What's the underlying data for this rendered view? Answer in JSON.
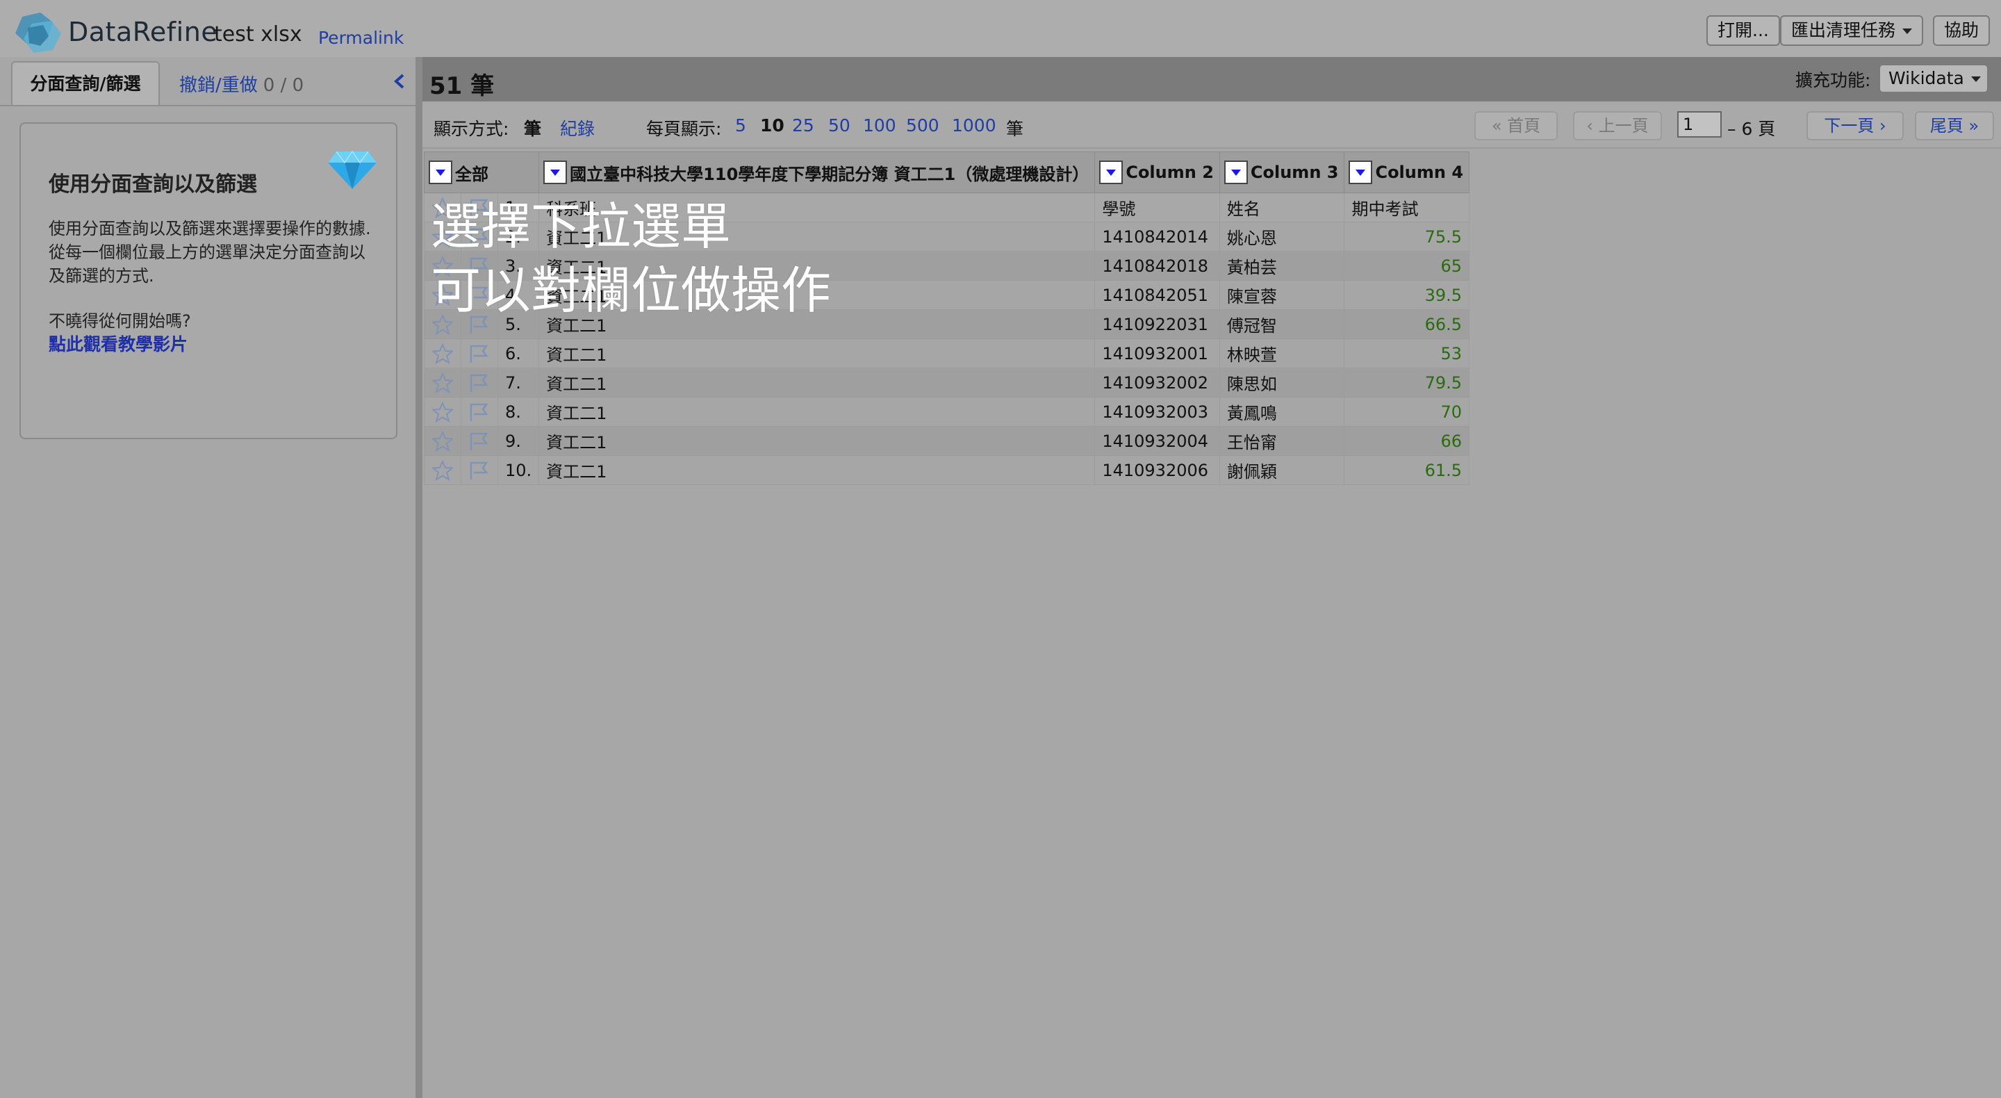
{
  "app": {
    "brand": "DataRefine",
    "project_name": "test xlsx",
    "permalink": "Permalink"
  },
  "header_buttons": {
    "open": "打開...",
    "export": "匯出清理任務",
    "help": "協助"
  },
  "left_panel": {
    "tabs": {
      "facet": "分面查詢/篩選",
      "undo": "撤銷/重做",
      "undo_count": "0 / 0"
    },
    "help_box": {
      "title": "使用分面查詢以及篩選",
      "body": "使用分面查詢以及篩選來選擇要操作的數據. 從每一個欄位最上方的選單決定分面查詢以及篩選的方式.",
      "question": "不曉得從何開始嗎?",
      "link": "點此觀看教學影片"
    }
  },
  "summary": {
    "count": "51 筆",
    "extensions_label": "擴充功能:",
    "extensions_value": "Wikidata"
  },
  "view_bar": {
    "show_as_label": "顯示方式:",
    "show_rows": "筆",
    "show_records": "紀錄",
    "per_page_label": "每頁顯示:",
    "page_sizes": [
      "5",
      "10",
      "25",
      "50",
      "100",
      "500",
      "1000"
    ],
    "per_page_suffix": "筆",
    "first": "« 首頁",
    "prev": "‹ 上一頁",
    "page_value": "1",
    "page_total": "– 6 頁",
    "next": "下一頁 ›",
    "last": "尾頁 »"
  },
  "table": {
    "columns": [
      "全部",
      "國立臺中科技大學110學年度下學期記分簿 資工二1（微處理機設計）",
      "Column 2",
      "Column 3",
      "Column 4"
    ],
    "rows": [
      {
        "idx": "1.",
        "col1": "科系班",
        "col2": "學號",
        "col3": "姓名",
        "col4": "期中考試"
      },
      {
        "idx": "2.",
        "col1": "資工二1",
        "col2": "1410842014",
        "col3": "姚心恩",
        "col4": "75.5"
      },
      {
        "idx": "3.",
        "col1": "資工二1",
        "col2": "1410842018",
        "col3": "黃柏芸",
        "col4": "65"
      },
      {
        "idx": "4.",
        "col1": "資工二1",
        "col2": "1410842051",
        "col3": "陳宣蓉",
        "col4": "39.5"
      },
      {
        "idx": "5.",
        "col1": "資工二1",
        "col2": "1410922031",
        "col3": "傅冠智",
        "col4": "66.5"
      },
      {
        "idx": "6.",
        "col1": "資工二1",
        "col2": "1410932001",
        "col3": "林映萱",
        "col4": "53"
      },
      {
        "idx": "7.",
        "col1": "資工二1",
        "col2": "1410932002",
        "col3": "陳思如",
        "col4": "79.5"
      },
      {
        "idx": "8.",
        "col1": "資工二1",
        "col2": "1410932003",
        "col3": "黃鳳鳴",
        "col4": "70"
      },
      {
        "idx": "9.",
        "col1": "資工二1",
        "col2": "1410932004",
        "col3": "王怡甯",
        "col4": "66"
      },
      {
        "idx": "10.",
        "col1": "資工二1",
        "col2": "1410932006",
        "col3": "謝佩穎",
        "col4": "61.5"
      }
    ]
  },
  "overlay": {
    "line1": "選擇下拉選單",
    "line2": "可以對欄位做操作"
  },
  "colors": {
    "link": "#1f3ea3",
    "number": "#2a6b10",
    "diamond": "#2ea8e6"
  }
}
